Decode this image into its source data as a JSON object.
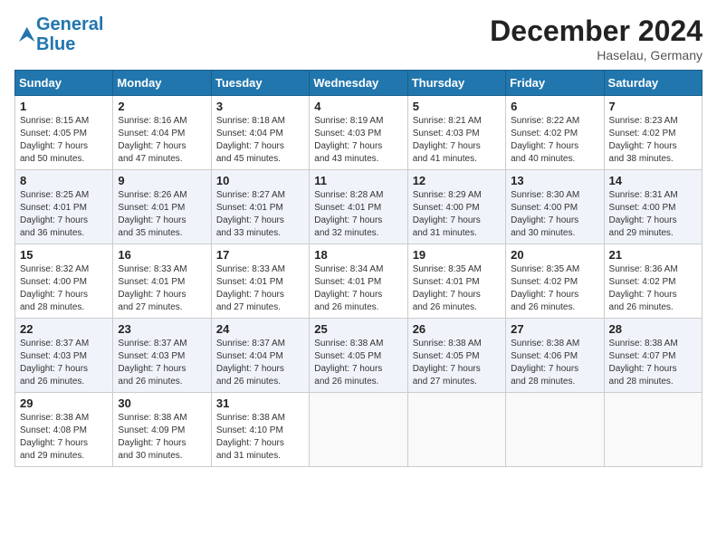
{
  "logo": {
    "line1": "General",
    "line2": "Blue"
  },
  "title": "December 2024",
  "location": "Haselau, Germany",
  "weekdays": [
    "Sunday",
    "Monday",
    "Tuesday",
    "Wednesday",
    "Thursday",
    "Friday",
    "Saturday"
  ],
  "weeks": [
    [
      {
        "day": "1",
        "info": "Sunrise: 8:15 AM\nSunset: 4:05 PM\nDaylight: 7 hours\nand 50 minutes."
      },
      {
        "day": "2",
        "info": "Sunrise: 8:16 AM\nSunset: 4:04 PM\nDaylight: 7 hours\nand 47 minutes."
      },
      {
        "day": "3",
        "info": "Sunrise: 8:18 AM\nSunset: 4:04 PM\nDaylight: 7 hours\nand 45 minutes."
      },
      {
        "day": "4",
        "info": "Sunrise: 8:19 AM\nSunset: 4:03 PM\nDaylight: 7 hours\nand 43 minutes."
      },
      {
        "day": "5",
        "info": "Sunrise: 8:21 AM\nSunset: 4:03 PM\nDaylight: 7 hours\nand 41 minutes."
      },
      {
        "day": "6",
        "info": "Sunrise: 8:22 AM\nSunset: 4:02 PM\nDaylight: 7 hours\nand 40 minutes."
      },
      {
        "day": "7",
        "info": "Sunrise: 8:23 AM\nSunset: 4:02 PM\nDaylight: 7 hours\nand 38 minutes."
      }
    ],
    [
      {
        "day": "8",
        "info": "Sunrise: 8:25 AM\nSunset: 4:01 PM\nDaylight: 7 hours\nand 36 minutes."
      },
      {
        "day": "9",
        "info": "Sunrise: 8:26 AM\nSunset: 4:01 PM\nDaylight: 7 hours\nand 35 minutes."
      },
      {
        "day": "10",
        "info": "Sunrise: 8:27 AM\nSunset: 4:01 PM\nDaylight: 7 hours\nand 33 minutes."
      },
      {
        "day": "11",
        "info": "Sunrise: 8:28 AM\nSunset: 4:01 PM\nDaylight: 7 hours\nand 32 minutes."
      },
      {
        "day": "12",
        "info": "Sunrise: 8:29 AM\nSunset: 4:00 PM\nDaylight: 7 hours\nand 31 minutes."
      },
      {
        "day": "13",
        "info": "Sunrise: 8:30 AM\nSunset: 4:00 PM\nDaylight: 7 hours\nand 30 minutes."
      },
      {
        "day": "14",
        "info": "Sunrise: 8:31 AM\nSunset: 4:00 PM\nDaylight: 7 hours\nand 29 minutes."
      }
    ],
    [
      {
        "day": "15",
        "info": "Sunrise: 8:32 AM\nSunset: 4:00 PM\nDaylight: 7 hours\nand 28 minutes."
      },
      {
        "day": "16",
        "info": "Sunrise: 8:33 AM\nSunset: 4:01 PM\nDaylight: 7 hours\nand 27 minutes."
      },
      {
        "day": "17",
        "info": "Sunrise: 8:33 AM\nSunset: 4:01 PM\nDaylight: 7 hours\nand 27 minutes."
      },
      {
        "day": "18",
        "info": "Sunrise: 8:34 AM\nSunset: 4:01 PM\nDaylight: 7 hours\nand 26 minutes."
      },
      {
        "day": "19",
        "info": "Sunrise: 8:35 AM\nSunset: 4:01 PM\nDaylight: 7 hours\nand 26 minutes."
      },
      {
        "day": "20",
        "info": "Sunrise: 8:35 AM\nSunset: 4:02 PM\nDaylight: 7 hours\nand 26 minutes."
      },
      {
        "day": "21",
        "info": "Sunrise: 8:36 AM\nSunset: 4:02 PM\nDaylight: 7 hours\nand 26 minutes."
      }
    ],
    [
      {
        "day": "22",
        "info": "Sunrise: 8:37 AM\nSunset: 4:03 PM\nDaylight: 7 hours\nand 26 minutes."
      },
      {
        "day": "23",
        "info": "Sunrise: 8:37 AM\nSunset: 4:03 PM\nDaylight: 7 hours\nand 26 minutes."
      },
      {
        "day": "24",
        "info": "Sunrise: 8:37 AM\nSunset: 4:04 PM\nDaylight: 7 hours\nand 26 minutes."
      },
      {
        "day": "25",
        "info": "Sunrise: 8:38 AM\nSunset: 4:05 PM\nDaylight: 7 hours\nand 26 minutes."
      },
      {
        "day": "26",
        "info": "Sunrise: 8:38 AM\nSunset: 4:05 PM\nDaylight: 7 hours\nand 27 minutes."
      },
      {
        "day": "27",
        "info": "Sunrise: 8:38 AM\nSunset: 4:06 PM\nDaylight: 7 hours\nand 28 minutes."
      },
      {
        "day": "28",
        "info": "Sunrise: 8:38 AM\nSunset: 4:07 PM\nDaylight: 7 hours\nand 28 minutes."
      }
    ],
    [
      {
        "day": "29",
        "info": "Sunrise: 8:38 AM\nSunset: 4:08 PM\nDaylight: 7 hours\nand 29 minutes."
      },
      {
        "day": "30",
        "info": "Sunrise: 8:38 AM\nSunset: 4:09 PM\nDaylight: 7 hours\nand 30 minutes."
      },
      {
        "day": "31",
        "info": "Sunrise: 8:38 AM\nSunset: 4:10 PM\nDaylight: 7 hours\nand 31 minutes."
      },
      {
        "day": "",
        "info": ""
      },
      {
        "day": "",
        "info": ""
      },
      {
        "day": "",
        "info": ""
      },
      {
        "day": "",
        "info": ""
      }
    ]
  ]
}
